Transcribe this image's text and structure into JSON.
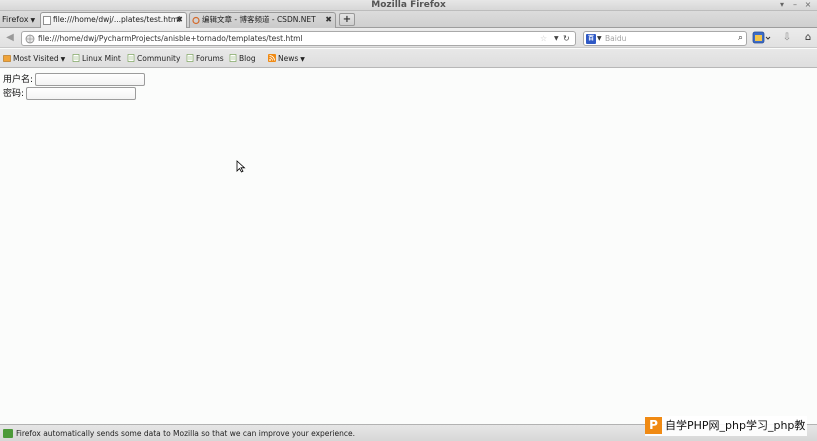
{
  "window": {
    "title": "Mozilla Firefox",
    "controls": [
      "▾",
      "–",
      "×"
    ]
  },
  "tabbar": {
    "menu_label": "Firefox",
    "tabs": [
      {
        "label": "file:///home/dwj/...plates/test.html",
        "active": true
      },
      {
        "label": "编辑文章 - 博客频道 - CSDN.NET",
        "active": false
      }
    ],
    "new_tab_label": "+"
  },
  "navbar": {
    "url": "file:///home/dwj/PycharmProjects/anisble+tornado/templates/test.html",
    "search_placeholder": "Baidu",
    "search_engine_label": "百"
  },
  "bookmarks": [
    {
      "label": "Most Visited",
      "icon": "folder-icon",
      "has_dropdown": true
    },
    {
      "label": "Linux Mint",
      "icon": "page-icon",
      "has_dropdown": false
    },
    {
      "label": "Community",
      "icon": "page-icon",
      "has_dropdown": false
    },
    {
      "label": "Forums",
      "icon": "page-icon",
      "has_dropdown": false
    },
    {
      "label": "Blog",
      "icon": "page-icon",
      "has_dropdown": false
    },
    {
      "label": "News",
      "icon": "rss-icon",
      "has_dropdown": true
    }
  ],
  "form": {
    "username_label": "用户名:",
    "username_value": "",
    "password_label": "密码:",
    "password_value": ""
  },
  "statusbar": {
    "message": "Firefox automatically sends some data to Mozilla so that we can improve your experience."
  },
  "watermark": {
    "logo": "P",
    "text": "自学PHP网_php学习_php教"
  },
  "colors": {
    "accent_green": "#4c9a39",
    "search_blue": "#2f59c5",
    "watermark_orange": "#f08a13"
  }
}
